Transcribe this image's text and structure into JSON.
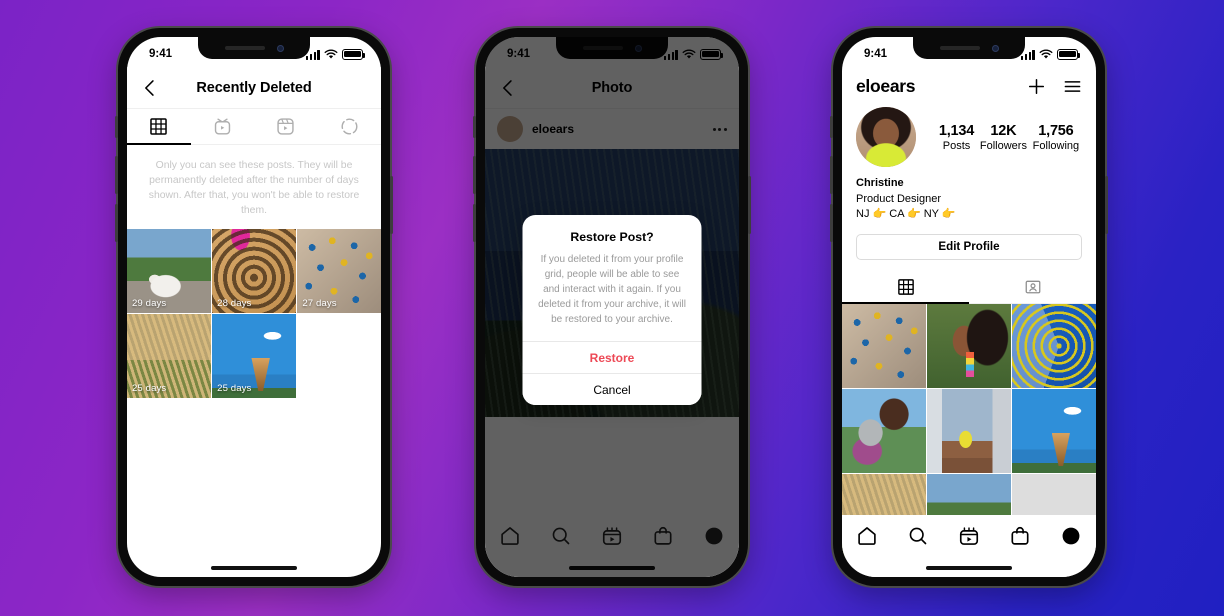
{
  "background": {
    "from": "#7b23c6",
    "mid": "#7a28c8",
    "to": "#2020c2"
  },
  "accent_danger": "#ed4956",
  "status_bar": {
    "time": "9:41",
    "signal_icon": "cellular-bars-icon",
    "wifi_icon": "wifi-icon",
    "battery_icon": "battery-icon"
  },
  "phone1": {
    "nav": {
      "back_icon": "chevron-left-icon",
      "title": "Recently Deleted"
    },
    "tabs": [
      {
        "name": "grid",
        "icon": "grid-icon",
        "active": true
      },
      {
        "name": "igtv",
        "icon": "igtv-icon",
        "active": false
      },
      {
        "name": "reels",
        "icon": "reels-icon",
        "active": false
      },
      {
        "name": "stories",
        "icon": "stories-circle-icon",
        "active": false
      }
    ],
    "notice": "Only you can see these posts. They will be permanently deleted after the number of days shown. After that, you won't be able to restore them.",
    "posts": [
      {
        "art": "a-dog",
        "days": "29 days"
      },
      {
        "art": "a-spiral",
        "days": "28 days"
      },
      {
        "art": "a-holds",
        "days": "27 days"
      },
      {
        "art": "a-wheat",
        "days": "25 days"
      },
      {
        "art": "a-cone",
        "days": "25 days"
      }
    ]
  },
  "phone2": {
    "nav": {
      "back_icon": "chevron-left-icon",
      "title": "Photo"
    },
    "post": {
      "username": "eloears",
      "avatar": "user-avatar",
      "more_icon": "more-options-icon",
      "photo_art": "a-night"
    },
    "dialog": {
      "title": "Restore Post?",
      "message": "If you deleted it from your profile grid, people will be able to see and interact with it again. If you deleted it from your archive, it will be restored to your archive.",
      "primary_action": "Restore",
      "secondary_action": "Cancel"
    },
    "tabbar": [
      {
        "name": "home",
        "icon": "home-icon"
      },
      {
        "name": "search",
        "icon": "search-icon"
      },
      {
        "name": "reels",
        "icon": "reels-icon"
      },
      {
        "name": "shop",
        "icon": "shop-bag-icon"
      },
      {
        "name": "profile",
        "icon": "profile-avatar-icon"
      }
    ]
  },
  "phone3": {
    "header": {
      "username": "eloears",
      "add_icon": "plus-icon",
      "menu_icon": "hamburger-menu-icon"
    },
    "avatar": "user-avatar",
    "stats": [
      {
        "num": "1,134",
        "label": "Posts"
      },
      {
        "num": "12K",
        "label": "Followers"
      },
      {
        "num": "1,756",
        "label": "Following"
      }
    ],
    "bio": {
      "name": "Christine",
      "role": "Product Designer",
      "locations": "NJ 👉 CA 👉 NY 👉"
    },
    "edit_profile": "Edit Profile",
    "tabs": [
      {
        "name": "grid",
        "icon": "grid-icon",
        "active": true
      },
      {
        "name": "tagged",
        "icon": "tagged-icon",
        "active": false
      }
    ],
    "grid_posts": [
      {
        "art": "a-holds"
      },
      {
        "art": "a-portrait"
      },
      {
        "art": "a-rings"
      },
      {
        "art": "a-friends"
      },
      {
        "art": "a-bldg"
      },
      {
        "art": "a-cone"
      },
      {
        "art": "a-wheat"
      },
      {
        "art": "a-dog"
      },
      {
        "art": "a-circle"
      }
    ],
    "tabbar": [
      {
        "name": "home",
        "icon": "home-icon"
      },
      {
        "name": "search",
        "icon": "search-icon"
      },
      {
        "name": "reels",
        "icon": "reels-icon"
      },
      {
        "name": "shop",
        "icon": "shop-bag-icon"
      },
      {
        "name": "profile",
        "icon": "profile-avatar-icon"
      }
    ]
  }
}
